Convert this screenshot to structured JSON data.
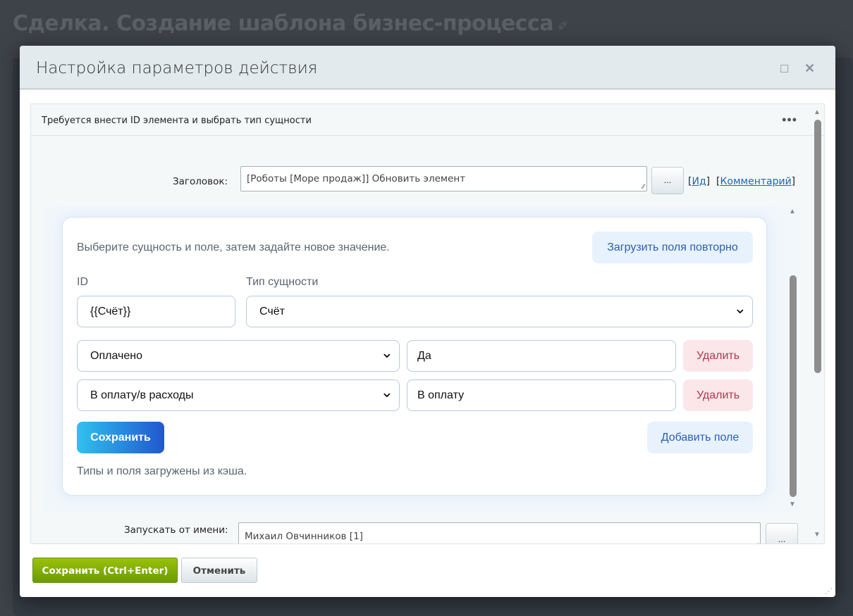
{
  "background": {
    "page_title": "Сделка. Создание шаблона бизнес-процесса"
  },
  "dialog": {
    "title": "Настройка параметров действия",
    "notice": "Требуется внести ID элемента и выбрать тип сущности",
    "title_label": "Заголовок:",
    "title_value": "[Роботы [Море продаж]] Обновить элемент",
    "dots_button": "...",
    "link_id": "Ид",
    "link_comment": "Комментарий",
    "run_as_label": "Запускать от имени:",
    "run_as_value": "Михаил Овчинников [1]",
    "save_button": "Сохранить (Ctrl+Enter)",
    "cancel_button": "Отменить"
  },
  "card": {
    "instruction": "Выберите сущность и поле, затем задайте новое значение.",
    "reload_button": "Загрузить поля повторно",
    "id_label": "ID",
    "id_value": "{{Счёт}}",
    "entity_label": "Тип сущности",
    "entity_value": "Счёт",
    "rows": [
      {
        "field": "Оплачено",
        "value": "Да",
        "delete": "Удалить"
      },
      {
        "field": "В оплату/в расходы",
        "value": "В оплату",
        "delete": "Удалить"
      }
    ],
    "save_button": "Сохранить",
    "add_field_button": "Добавить поле",
    "status": "Типы и поля загружены из кэша."
  }
}
